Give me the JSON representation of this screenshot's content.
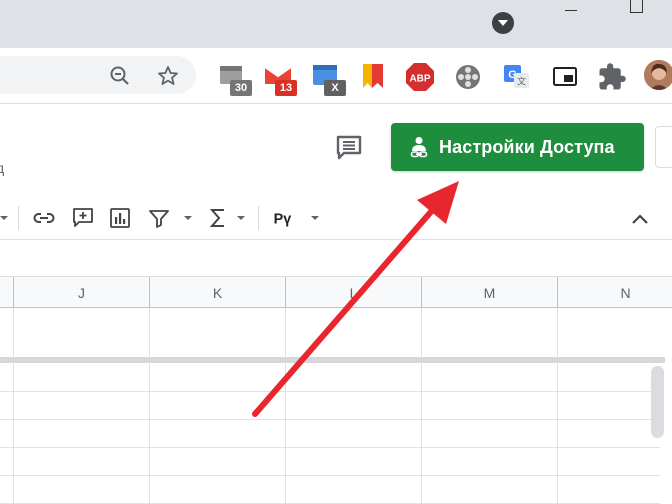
{
  "browser": {
    "extensions": [
      {
        "name": "calendar-extension",
        "badge": "30",
        "badge_color": "#757575"
      },
      {
        "name": "gmail-extension",
        "badge": "13",
        "badge_color": "#d93025"
      },
      {
        "name": "x-extension",
        "badge": "X",
        "badge_color": "#616161"
      },
      {
        "name": "bookmark-extension",
        "badge": "",
        "badge_color": ""
      },
      {
        "name": "adblock-extension",
        "badge": "ABP",
        "badge_color": "#d93025"
      },
      {
        "name": "film-extension",
        "badge": "",
        "badge_color": ""
      },
      {
        "name": "translate-extension",
        "badge": "",
        "badge_color": ""
      },
      {
        "name": "pip-extension",
        "badge": "",
        "badge_color": ""
      },
      {
        "name": "puzzle-extension",
        "badge": "",
        "badge_color": ""
      }
    ]
  },
  "sheets": {
    "share_button_label": "Настройки Доступа",
    "menu_fragment": "д",
    "accent_green": "#1e8e3e",
    "toolbar_font_label": "Рү",
    "columns": [
      "J",
      "K",
      "L",
      "M",
      "N"
    ]
  },
  "annotation": {
    "arrow_color": "#e8262d"
  }
}
